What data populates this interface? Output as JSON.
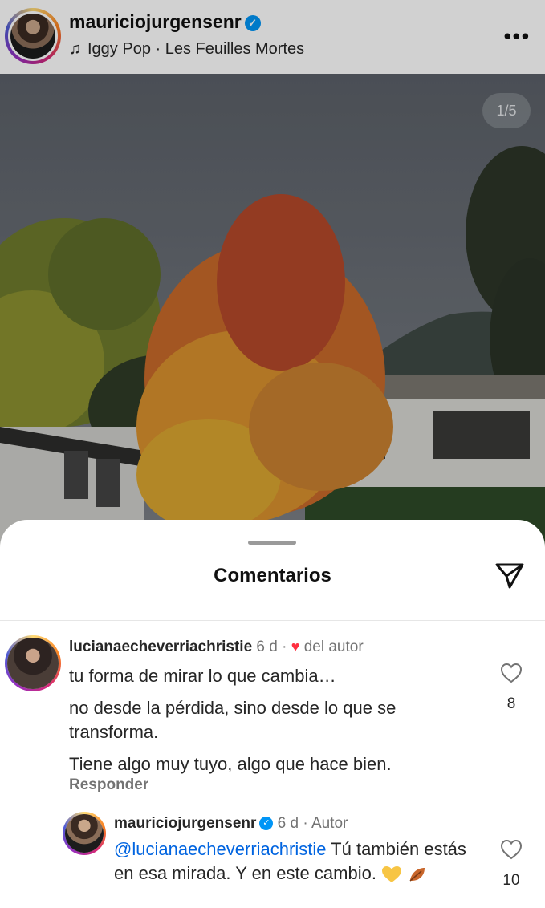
{
  "post": {
    "username": "mauriciojurgensenr",
    "music": "Iggy Pop · Les Feuilles Mortes",
    "more_icon": "more-horizontal-icon",
    "page_indicator": "1/5"
  },
  "comments_sheet": {
    "title": "Comentarios",
    "share_icon": "send-paper-plane-icon"
  },
  "comments": [
    {
      "username": "lucianaecheverriachristie",
      "time": "6 d",
      "liked_by_author_label": "del autor",
      "lines": [
        "tu forma de mirar lo que cambia…",
        "no desde la pérdida, sino desde lo que se transforma.",
        "Tiene algo muy tuyo, algo que hace bien."
      ],
      "reply_label": "Responder",
      "like_count": "8"
    }
  ],
  "reply": {
    "username": "mauriciojurgensenr",
    "time": "6 d",
    "role": "Autor",
    "mention": "@lucianaecheverriachristie",
    "text": "Tú también estás en esa mirada. Y en este cambio.",
    "like_count": "10"
  },
  "colors": {
    "accent_blue": "#0095f6",
    "mention_blue": "#0064e0",
    "heart_red": "#ff3040"
  }
}
